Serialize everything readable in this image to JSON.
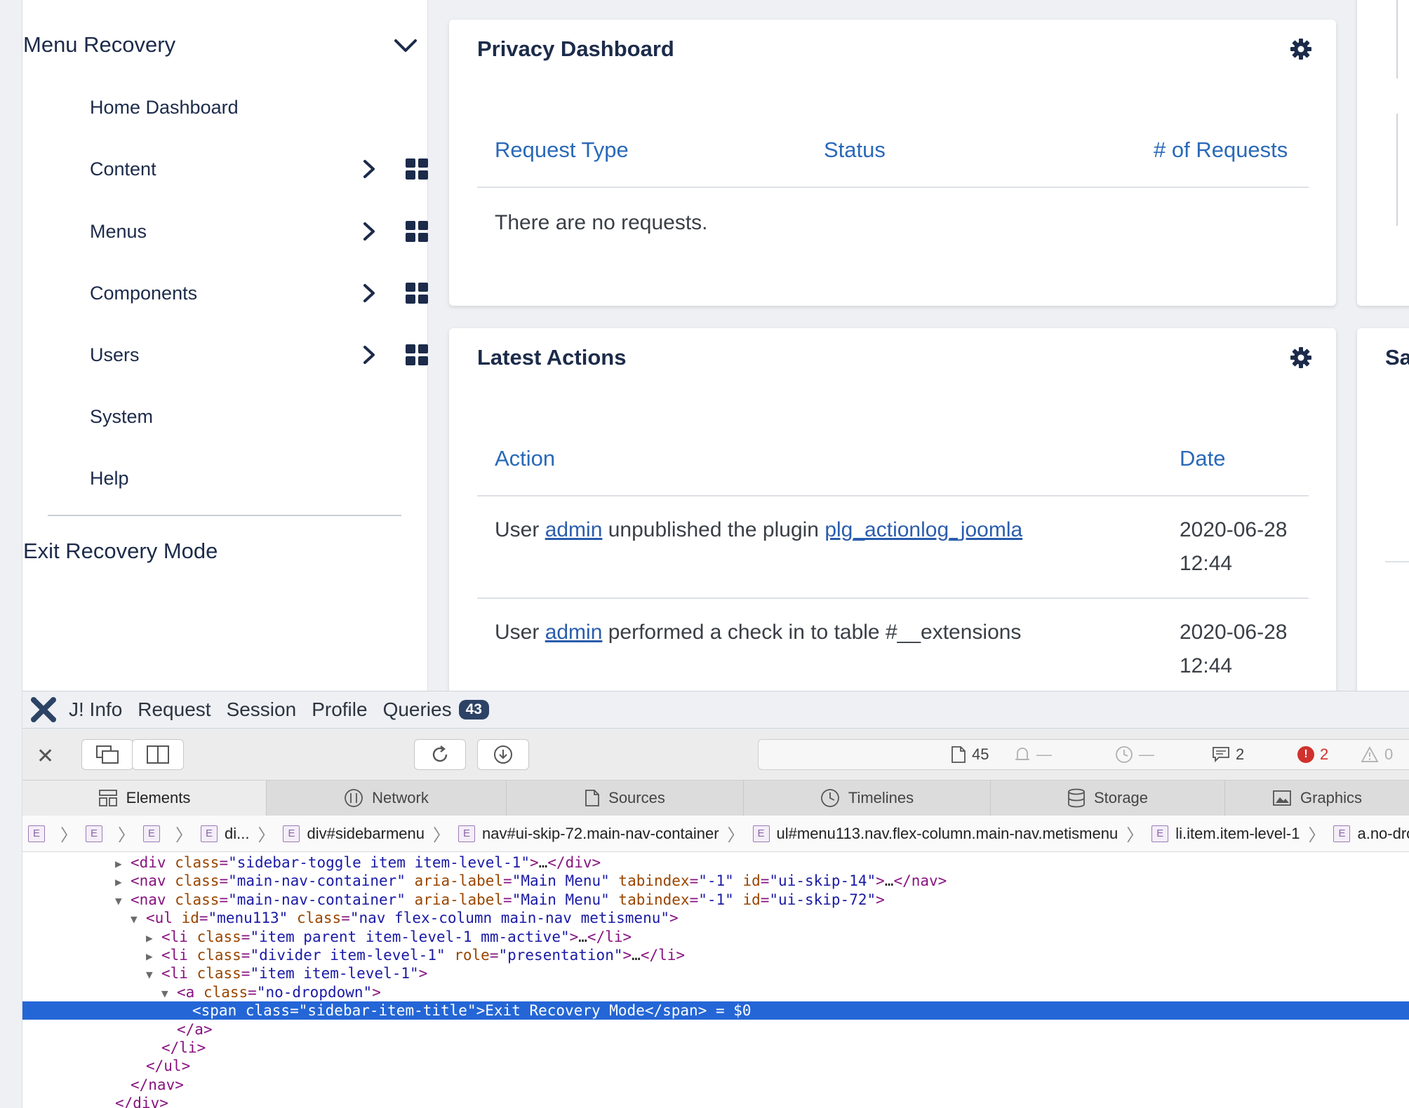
{
  "sidebar": {
    "title": "Menu Recovery",
    "items": [
      {
        "label": "Home Dashboard",
        "has_children": false
      },
      {
        "label": "Content",
        "has_children": true
      },
      {
        "label": "Menus",
        "has_children": true
      },
      {
        "label": "Components",
        "has_children": true
      },
      {
        "label": "Users",
        "has_children": true
      },
      {
        "label": "System",
        "has_children": false
      },
      {
        "label": "Help",
        "has_children": false
      }
    ],
    "exit_label": "Exit Recovery Mode"
  },
  "privacy_card": {
    "title": "Privacy Dashboard",
    "headers": [
      "Request Type",
      "Status",
      "# of Requests"
    ],
    "empty_text": "There are no requests."
  },
  "latest_actions": {
    "title": "Latest Actions",
    "headers": [
      "Action",
      "Date"
    ],
    "rows": [
      {
        "prefix": "User ",
        "user": "admin",
        "middle": " unpublished the plugin ",
        "link": "plg_actionlog_joomla",
        "suffix": "",
        "date": "2020-06-28",
        "time": "12:44"
      },
      {
        "prefix": "User ",
        "user": "admin",
        "middle": " performed a check in to table #__extensions",
        "link": "",
        "suffix": "",
        "date": "2020-06-28",
        "time": "12:44"
      }
    ]
  },
  "right_card": {
    "title_fragment": "Sa"
  },
  "debugbar": {
    "tabs": [
      "J! Info",
      "Request",
      "Session",
      "Profile",
      "Queries"
    ],
    "queries_count": "43"
  },
  "devtools": {
    "status": {
      "resources": "45",
      "bell": "—",
      "time": "—",
      "logs": "2",
      "errors": "2",
      "warnings": "0"
    },
    "tabs": [
      "Elements",
      "Network",
      "Sources",
      "Timelines",
      "Storage",
      "Graphics"
    ],
    "breadcrumb": [
      "",
      "",
      "",
      "di...",
      "div#sidebarmenu",
      "nav#ui-skip-72.main-nav-container",
      "ul#menu113.nav.flex-column.main-nav.metismenu",
      "li.item.item-level-1",
      "a.no-dro"
    ],
    "dom_lines": [
      {
        "tri": "▶",
        "text": "<div class=\"sidebar-toggle item item-level-1\">…</div>"
      },
      {
        "tri": "▶",
        "text": "<nav class=\"main-nav-container\" aria-label=\"Main Menu\" tabindex=\"-1\" id=\"ui-skip-14\">…</nav>"
      },
      {
        "tri": "▼",
        "text": "<nav class=\"main-nav-container\" aria-label=\"Main Menu\" tabindex=\"-1\" id=\"ui-skip-72\">"
      },
      {
        "tri": "▼",
        "text": "<ul id=\"menu113\" class=\"nav flex-column main-nav metismenu\">"
      },
      {
        "tri": "▶",
        "text": "<li class=\"item parent item-level-1 mm-active\">…</li>"
      },
      {
        "tri": "▶",
        "text": "<li class=\"divider item-level-1\" role=\"presentation\">…</li>"
      },
      {
        "tri": "▼",
        "text": "<li class=\"item item-level-1\">"
      },
      {
        "tri": "▼",
        "text": "<a class=\"no-dropdown\">"
      },
      {
        "tri": "",
        "text": "<span class=\"sidebar-item-title\">Exit Recovery Mode</span> = $0"
      },
      {
        "tri": "",
        "text": "</a>"
      },
      {
        "tri": "",
        "text": "</li>"
      },
      {
        "tri": "",
        "text": "</ul>"
      },
      {
        "tri": "",
        "text": "</nav>"
      },
      {
        "tri": "",
        "text": "</div>"
      }
    ]
  }
}
